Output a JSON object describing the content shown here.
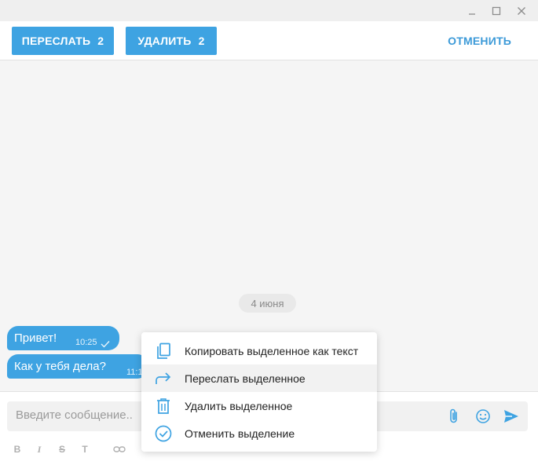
{
  "selection": {
    "forward_label": "ПЕРЕСЛАТЬ",
    "forward_count": "2",
    "delete_label": "УДАЛИТЬ",
    "delete_count": "2",
    "cancel_label": "ОТМЕНИТЬ"
  },
  "chat": {
    "date": "4 июня",
    "messages": [
      {
        "text": "Привет!",
        "time": "10:25"
      },
      {
        "text": "Как у тебя дела?",
        "time": "11:1"
      }
    ]
  },
  "composer": {
    "placeholder": "Введите сообщение..",
    "format_buttons": [
      "B",
      "I",
      "S",
      "T"
    ]
  },
  "context_menu": {
    "items": [
      {
        "label": "Копировать выделенное как текст",
        "icon": "copy-icon"
      },
      {
        "label": "Переслать выделенное",
        "icon": "forward-icon"
      },
      {
        "label": "Удалить выделенное",
        "icon": "trash-icon"
      },
      {
        "label": "Отменить выделение",
        "icon": "check-circle-icon"
      }
    ]
  },
  "colors": {
    "accent": "#3ea3e2",
    "link": "#3c9ad8"
  }
}
